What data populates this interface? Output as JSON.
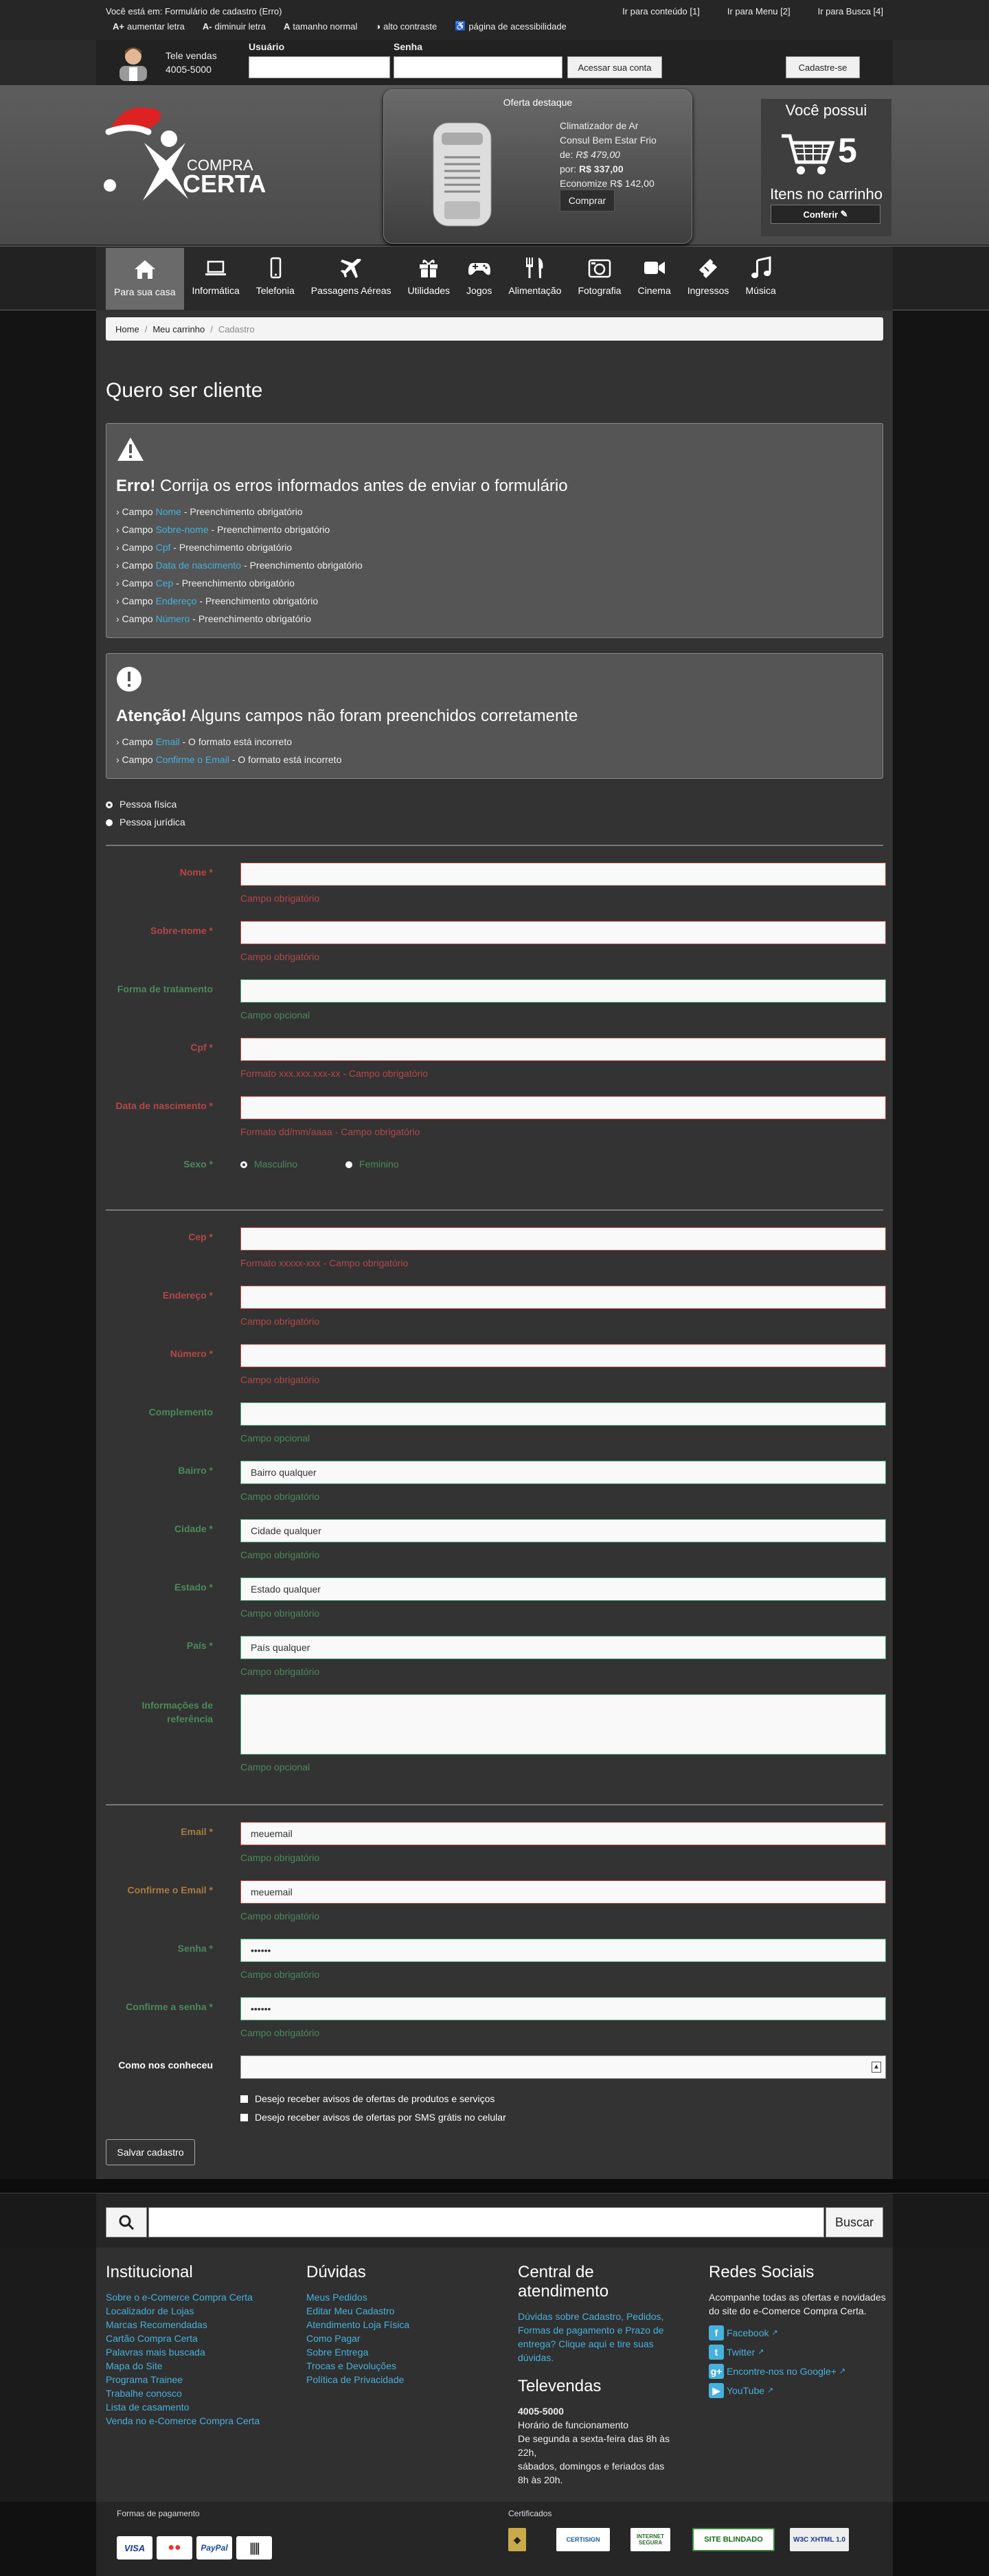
{
  "topbar": {
    "location": "Você está em: Formulário de cadastro (Erro)",
    "skip_links": [
      "Ir para conteúdo [1]",
      "Ir para Menu [2]",
      "Ir para Busca [4]"
    ],
    "accessibility": [
      {
        "glyph": "A+",
        "label": "aumentar letra"
      },
      {
        "glyph": "A-",
        "label": "diminuir letra"
      },
      {
        "glyph": "A",
        "label": "tamanho normal"
      },
      {
        "glyph": "◑",
        "label": "alto contraste"
      },
      {
        "glyph": "♿",
        "label": "página de acessibilidade"
      }
    ]
  },
  "login": {
    "tele_label": "Tele vendas",
    "tele_number": "4005-5000",
    "user_label": "Usuário",
    "pass_label": "Senha",
    "submit_label": "Acessar sua conta",
    "register_label": "Cadastre-se"
  },
  "logo": {
    "line1": "COMPRA",
    "line2": "CERTA"
  },
  "featured": {
    "title": "Oferta destaque",
    "product_line1": "Climatizador de Ar",
    "product_line2": "Consul Bem Estar Frio",
    "old_price_label": "de:",
    "old_price": "R$ 479,00",
    "price_label": "por:",
    "price": "R$ 337,00",
    "savings": "Economize R$ 142,00",
    "buy_label": "Comprar"
  },
  "cart": {
    "title": "Você possui",
    "count": "5",
    "subtitle": "Itens no carrinho",
    "check_label": "Conferir"
  },
  "nav": [
    {
      "label": "Para sua casa",
      "icon": "home-icon",
      "active": true
    },
    {
      "label": "Informática",
      "icon": "laptop-icon",
      "active": false
    },
    {
      "label": "Telefonia",
      "icon": "phone-icon",
      "active": false
    },
    {
      "label": "Passagens Aéreas",
      "icon": "plane-icon",
      "active": false
    },
    {
      "label": "Utilidades",
      "icon": "gift-icon",
      "active": false
    },
    {
      "label": "Jogos",
      "icon": "gamepad-icon",
      "active": false
    },
    {
      "label": "Alimentação",
      "icon": "cutlery-icon",
      "active": false
    },
    {
      "label": "Fotografia",
      "icon": "camera-icon",
      "active": false
    },
    {
      "label": "Cinema",
      "icon": "video-icon",
      "active": false
    },
    {
      "label": "Ingressos",
      "icon": "ticket-icon",
      "active": false
    },
    {
      "label": "Música",
      "icon": "music-icon",
      "active": false
    }
  ],
  "breadcrumb": [
    "Home",
    "Meu carrinho",
    "Cadastro"
  ],
  "page_title": "Quero ser cliente",
  "error_box": {
    "strong": "Erro!",
    "message": "Corrija os erros informados antes de enviar o formulário",
    "items": [
      {
        "field": "Nome",
        "msg": "Preenchimento obrigatório"
      },
      {
        "field": "Sobre-nome",
        "msg": "Preenchimento obrigatório"
      },
      {
        "field": "Cpf",
        "msg": "Preenchimento obrigatório"
      },
      {
        "field": "Data de nascimento",
        "msg": "Preenchimento obrigatório"
      },
      {
        "field": "Cep",
        "msg": "Preenchimento obrigatório"
      },
      {
        "field": "Endereço",
        "msg": "Preenchimento obrigatório"
      },
      {
        "field": "Número",
        "msg": "Preenchimento obrigatório"
      }
    ]
  },
  "warn_box": {
    "strong": "Atenção!",
    "message": "Alguns campos não foram preenchidos corretamente",
    "items": [
      {
        "field": "Email",
        "msg": "O formato está incorreto"
      },
      {
        "field": "Confirme o Email",
        "msg": "O formato está incorreto"
      }
    ]
  },
  "field_prefix": "› Campo",
  "person_type": {
    "fisica": "Pessoa física",
    "juridica": "Pessoa jurídica"
  },
  "section1": [
    {
      "label": "Nome *",
      "value": "",
      "help": "Campo obrigatório",
      "state": "red"
    },
    {
      "label": "Sobre-nome *",
      "value": "",
      "help": "Campo obrigatório",
      "state": "red"
    },
    {
      "label": "Forma de tratamento",
      "value": "",
      "help": "Campo opcional",
      "state": "green"
    },
    {
      "label": "Cpf *",
      "value": "",
      "help": "Formato xxx.xxx.xxx-xx - Campo obrigatório",
      "state": "red"
    },
    {
      "label": "Data de nascimento *",
      "value": "",
      "help": "Formato dd/mm/aaaa - Campo obrigatório",
      "state": "red"
    }
  ],
  "sexo": {
    "label": "Sexo *",
    "masc": "Masculino",
    "fem": "Feminino"
  },
  "section2": [
    {
      "label": "Cep *",
      "value": "",
      "help": "Formato xxxxx-xxx - Campo obrigatório",
      "state": "red"
    },
    {
      "label": "Endereço *",
      "value": "",
      "help": "Campo obrigatório",
      "state": "red"
    },
    {
      "label": "Número *",
      "value": "",
      "help": "Campo obrigatório",
      "state": "red"
    },
    {
      "label": "Complemento",
      "value": "",
      "help": "Campo opcional",
      "state": "green"
    },
    {
      "label": "Bairro *",
      "value": "Bairro qualquer",
      "help": "Campo obrigatório",
      "state": "green"
    },
    {
      "label": "Cidade *",
      "value": "Cidade qualquer",
      "help": "Campo obrigatório",
      "state": "green"
    },
    {
      "label": "Estado *",
      "value": "Estado qualquer",
      "help": "Campo obrigatório",
      "state": "green"
    },
    {
      "label": "País *",
      "value": "País qualquer",
      "help": "Campo obrigatório",
      "state": "green"
    }
  ],
  "referencia": {
    "label_line1": "Informações de",
    "label_line2": "referência",
    "help": "Campo opcional"
  },
  "section3": [
    {
      "label": "Email *",
      "value": "meuemail",
      "help": "Campo obrigatório",
      "state": "orange"
    },
    {
      "label": "Confirme o Email *",
      "value": "meuemail",
      "help": "Campo obrigatório",
      "state": "orange"
    },
    {
      "label": "Senha *",
      "value": "••••••",
      "help": "Campo obrigatório",
      "state": "green"
    },
    {
      "label": "Confirme a senha *",
      "value": "••••••",
      "help": "Campo obrigatório",
      "state": "green"
    }
  ],
  "como_conheceu": {
    "label": "Como nos conheceu"
  },
  "checkboxes": [
    "Desejo receber avisos de ofertas de produtos e serviços",
    "Desejo receber avisos de ofertas por SMS grátis no celular"
  ],
  "save_label": "Salvar cadastro",
  "search": {
    "button": "Buscar",
    "placeholder": ""
  },
  "footer": {
    "institucional": {
      "title": "Institucional",
      "links": [
        "Sobre o e-Comerce Compra Certa",
        "Localizador de Lojas",
        "Marcas Recomendadas",
        "Cartão Compra Certa",
        "Palavras mais buscada",
        "Mapa do Site",
        "Programa Trainee",
        "Trabalhe conosco",
        "Lista de casamento",
        "Venda no e-Comerce Compra Certa"
      ]
    },
    "duvidas": {
      "title": "Dúvidas",
      "links": [
        "Meus Pedidos",
        "Editar Meu Cadastro",
        "Atendimento Loja Física",
        "Como Pagar",
        "Sobre Entrega",
        "Trocas e Devoluções",
        "Política de Privacidade"
      ]
    },
    "central": {
      "title_line1": "Central de",
      "title_line2": "atendimento",
      "text": "Dúvidas sobre Cadastro, Pedidos, Formas de pagamento e Prazo de entrega? Clique aqui e tire suas dúvidas.",
      "tele_title": "Televendas",
      "tele_number": "4005-5000",
      "hours_title": "Horário de funcionamento",
      "hours1": "De segunda a sexta-feira das 8h às 22h,",
      "hours2": "sábados, domingos e feriados das 8h às 20h."
    },
    "redes": {
      "title": "Redes Sociais",
      "text": "Acompanhe todas as ofertas e novidades do site do e-Comerce Compra Certa.",
      "links": [
        {
          "label": "Facebook",
          "glyph": "f"
        },
        {
          "label": "Twitter",
          "glyph": "t"
        },
        {
          "label": "Encontre-nos no Google+",
          "glyph": "g+"
        },
        {
          "label": "YouTube",
          "glyph": "▶"
        }
      ]
    }
  },
  "bottom": {
    "payment_title": "Formas de pagamento",
    "payments": [
      "VISA",
      "●●",
      "PayPal",
      "|||||"
    ],
    "cert_title": "Certificados",
    "certs": [
      "◆",
      "CERTISIGN",
      "INTERNET SEGURA",
      "SITE BLINDADO",
      "W3C XHTML 1.0"
    ]
  },
  "colors": {
    "accent": "#46b1dc",
    "error": "#b54747",
    "ok": "#4a8a5a",
    "warn": "#a87b43"
  }
}
